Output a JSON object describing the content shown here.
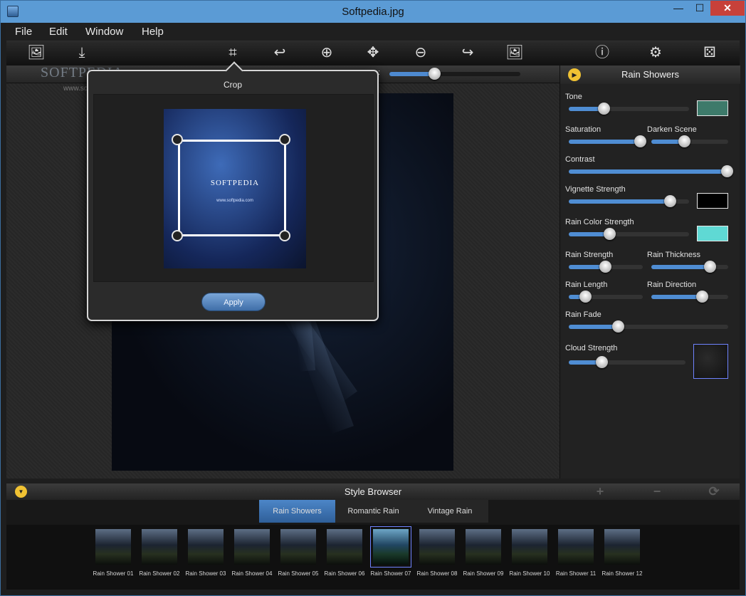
{
  "window": {
    "title": "Softpedia.jpg",
    "minimize": "—",
    "maximize": "☐",
    "close": "✕"
  },
  "menu": [
    "File",
    "Edit",
    "Window",
    "Help"
  ],
  "toolbar": [
    {
      "icon": "image-open-icon",
      "glyph": "🖼"
    },
    {
      "icon": "save-icon",
      "glyph": "⤓"
    },
    {
      "icon": "crop-icon",
      "glyph": "⌗"
    },
    {
      "icon": "rotate-icon",
      "glyph": "↩"
    },
    {
      "icon": "zoom-in-icon",
      "glyph": "⊕"
    },
    {
      "icon": "move-icon",
      "glyph": "✥"
    },
    {
      "icon": "zoom-out-icon",
      "glyph": "⊖"
    },
    {
      "icon": "redo-icon",
      "glyph": "↪"
    },
    {
      "icon": "fit-image-icon",
      "glyph": "🖼"
    },
    {
      "icon": "info-icon",
      "glyph": "ⓘ"
    },
    {
      "icon": "settings-icon",
      "glyph": "⚙"
    },
    {
      "icon": "random-dice-icon",
      "glyph": "⚄"
    }
  ],
  "zoom": {
    "label": ":",
    "value": 0.34
  },
  "watermark": {
    "brand": "SOFTPEDIA",
    "url": "www.softpedia.com"
  },
  "crop": {
    "title": "Crop",
    "thumb_brand": "SOFTPEDIA",
    "thumb_url": "www.softpedia.com",
    "apply": "Apply"
  },
  "panel": {
    "title": "Rain Showers",
    "controls": {
      "tone": {
        "label": "Tone",
        "value": 0.29,
        "swatch": "#3d7a6a"
      },
      "saturation": {
        "label": "Saturation",
        "value": 0.93
      },
      "darken_scene": {
        "label": "Darken Scene",
        "value": 0.43
      },
      "contrast": {
        "label": "Contrast",
        "value": 0.99
      },
      "vignette_strength": {
        "label": "Vignette Strength",
        "value": 0.84,
        "swatch": "#000000"
      },
      "rain_color_strength": {
        "label": "Rain Color Strength",
        "value": 0.34,
        "swatch": "#5fd9d4"
      },
      "rain_strength": {
        "label": "Rain Strength",
        "value": 0.49
      },
      "rain_thickness": {
        "label": "Rain Thickness",
        "value": 0.76
      },
      "rain_length": {
        "label": "Rain Length",
        "value": 0.22
      },
      "rain_direction": {
        "label": "Rain Direction",
        "value": 0.66
      },
      "rain_fade": {
        "label": "Rain Fade",
        "value": 0.31
      },
      "cloud_strength": {
        "label": "Cloud Strength",
        "value": 0.28
      }
    }
  },
  "style_browser": {
    "title": "Style Browser",
    "add": "+",
    "remove": "−",
    "reset": "⟳",
    "tabs": [
      "Rain Showers",
      "Romantic Rain",
      "Vintage Rain"
    ],
    "active_tab": 0,
    "items": [
      "Rain Shower 01",
      "Rain Shower 02",
      "Rain Shower 03",
      "Rain Shower 04",
      "Rain Shower 05",
      "Rain Shower 06",
      "Rain Shower 07",
      "Rain Shower 08",
      "Rain Shower 09",
      "Rain Shower 10",
      "Rain Shower 11",
      "Rain Shower 12"
    ],
    "selected_item": 6
  }
}
